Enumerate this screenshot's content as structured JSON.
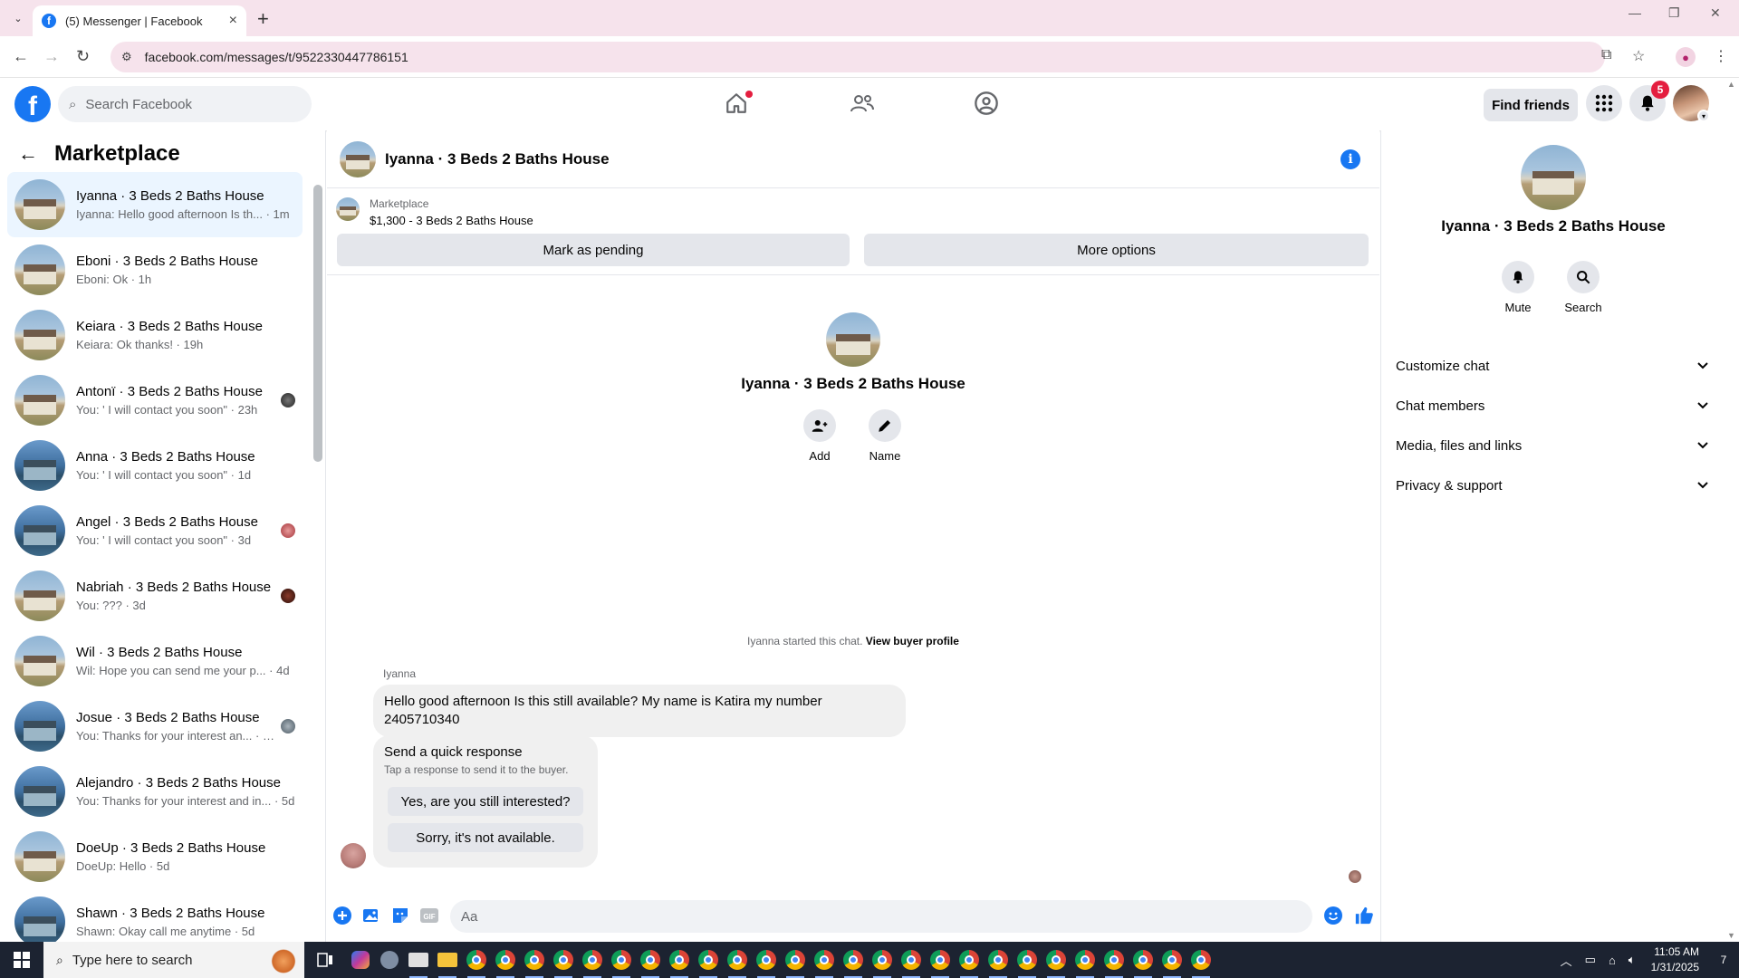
{
  "browser": {
    "tab_title": "(5) Messenger | Facebook",
    "url": "facebook.com/messages/t/9522330447786151"
  },
  "header": {
    "search_placeholder": "Search Facebook",
    "find_friends": "Find friends",
    "notif_count": "5"
  },
  "sidebar": {
    "title": "Marketplace",
    "conversations": [
      {
        "name": "Iyanna · 3 Beds 2 Baths House",
        "preview": "Iyanna: Hello good afternoon Is th... · 1m",
        "active": true
      },
      {
        "name": "Eboni · 3 Beds 2 Baths House",
        "preview": "Eboni: Ok · 1h"
      },
      {
        "name": "Keiara · 3 Beds 2 Baths House",
        "preview": "Keiara: Ok thanks! · 19h"
      },
      {
        "name": "Antonï · 3 Beds 2 Baths House",
        "preview": "You: ' I will contact you soon\" · 23h"
      },
      {
        "name": "Anna · 3 Beds 2 Baths House",
        "preview": "You: ' I will contact you soon\" · 1d"
      },
      {
        "name": "Angel · 3 Beds 2 Baths House",
        "preview": "You: ' I will contact you soon\" · 3d"
      },
      {
        "name": "Nabriah · 3 Beds 2 Baths House",
        "preview": "You: ??? · 3d"
      },
      {
        "name": "Wil · 3 Beds 2 Baths House",
        "preview": "Wil: Hope you can send me your p... · 4d"
      },
      {
        "name": "Josue · 3 Beds 2 Baths House",
        "preview": "You: Thanks for your interest an... · 4d"
      },
      {
        "name": "Alejandro · 3 Beds 2 Baths House",
        "preview": "You: Thanks for your interest and in... · 5d"
      },
      {
        "name": "DoeUp · 3 Beds 2 Baths House",
        "preview": "DoeUp: Hello · 5d"
      },
      {
        "name": "Shawn · 3 Beds 2 Baths House",
        "preview": "Shawn: Okay call me anytime · 5d"
      }
    ]
  },
  "chat": {
    "title": "Iyanna · 3 Beds 2 Baths House",
    "marketplace_label": "Marketplace",
    "listing": "$1,300 - 3 Beds 2 Baths House",
    "mark_pending": "Mark as pending",
    "more_options": "More options",
    "intro_name": "Iyanna · 3 Beds 2 Baths House",
    "add_label": "Add",
    "name_label": "Name",
    "started_text": "Iyanna started this chat.",
    "view_buyer": "View buyer profile",
    "sender": "Iyanna",
    "message": "Hello good afternoon Is this still available? My name is Katira my number 2405710340",
    "quick_title": "Send a quick response",
    "quick_sub": "Tap a response to send it to the buyer.",
    "quick_yes": "Yes, are you still interested?",
    "quick_no": "Sorry, it's not available.",
    "composer_placeholder": "Aa"
  },
  "right_panel": {
    "name": "Iyanna · 3 Beds 2 Baths House",
    "mute": "Mute",
    "search": "Search",
    "sections": [
      "Customize chat",
      "Chat members",
      "Media, files and links",
      "Privacy & support"
    ]
  },
  "taskbar": {
    "search_placeholder": "Type here to search",
    "time": "11:05 AM",
    "date": "1/31/2025",
    "notifications": "7"
  },
  "colors": {
    "fb_blue": "#1877f2",
    "tab_strip": "#f6e3ec",
    "active_conv": "#ebf5ff",
    "taskbar": "#1c2331"
  }
}
